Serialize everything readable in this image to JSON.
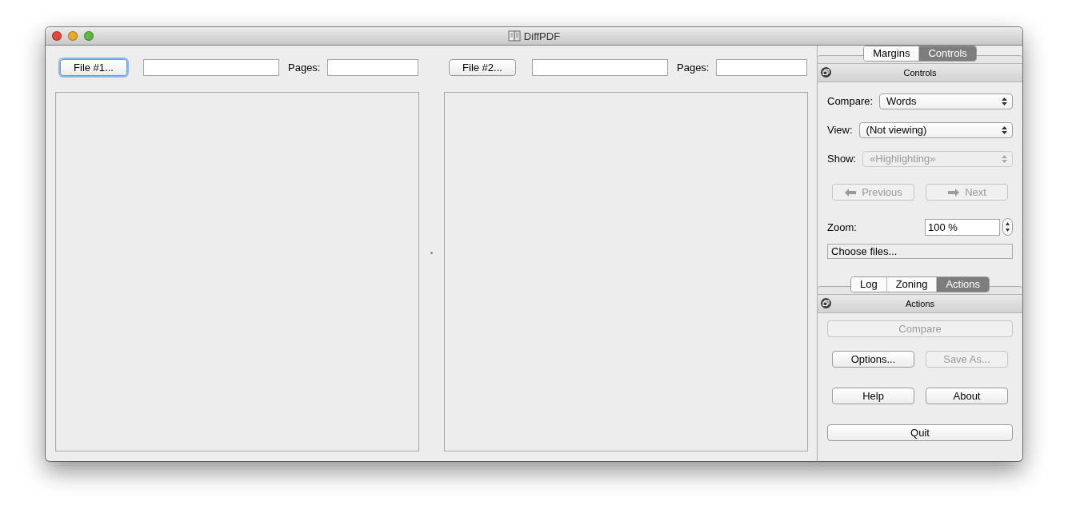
{
  "window": {
    "title": "DiffPDF"
  },
  "files": [
    {
      "button": "File #1...",
      "focused": true,
      "pages_label": "Pages:"
    },
    {
      "button": "File #2...",
      "focused": false,
      "pages_label": "Pages:"
    }
  ],
  "controls_dock": {
    "tabs": [
      {
        "label": "Margins",
        "selected": false
      },
      {
        "label": "Controls",
        "selected": true
      }
    ],
    "title": "Controls",
    "fields": [
      {
        "label": "Compare:",
        "value": "Words",
        "disabled": false
      },
      {
        "label": "View:",
        "value": "(Not viewing)",
        "disabled": false
      },
      {
        "label": "Show:",
        "value": "«Highlighting»",
        "disabled": true
      }
    ],
    "nav_buttons": [
      {
        "label": "Previous",
        "kind": "left",
        "disabled": true
      },
      {
        "label": "Next",
        "kind": "right",
        "disabled": true
      }
    ],
    "zoom": {
      "label": "Zoom:",
      "value": "100 %"
    },
    "status": "Choose files..."
  },
  "actions_dock": {
    "tabs": [
      {
        "label": "Log",
        "selected": false
      },
      {
        "label": "Zoning",
        "selected": false
      },
      {
        "label": "Actions",
        "selected": true
      }
    ],
    "title": "Actions",
    "rows": [
      [
        {
          "label": "Compare",
          "disabled": true
        }
      ],
      [
        {
          "label": "Options...",
          "disabled": false
        },
        {
          "label": "Save As...",
          "disabled": true
        }
      ],
      [
        {
          "label": "Help",
          "disabled": false
        },
        {
          "label": "About",
          "disabled": false
        }
      ],
      [
        {
          "label": "Quit",
          "disabled": false
        }
      ]
    ]
  }
}
